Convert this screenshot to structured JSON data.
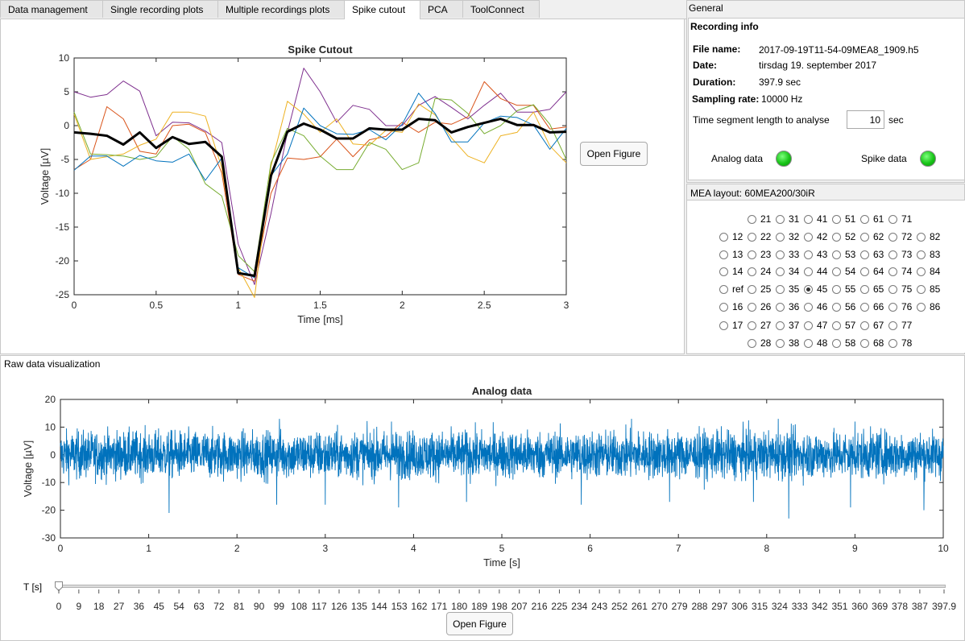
{
  "tabs": [
    {
      "label": "Data management",
      "active": false
    },
    {
      "label": "Single recording plots",
      "active": false
    },
    {
      "label": "Multiple recordings plots",
      "active": false
    },
    {
      "label": "Spike cutout",
      "active": true
    },
    {
      "label": "PCA",
      "active": false
    },
    {
      "label": "ToolConnect",
      "active": false
    }
  ],
  "general": {
    "title": "General",
    "recording_info": {
      "title": "Recording info",
      "file_name_label": "File name:",
      "file_name": "2017-09-19T11-54-09MEA8_1909.h5",
      "date_label": "Date:",
      "date": "tirsdag 19. september 2017",
      "duration_label": "Duration:",
      "duration": "397.9 sec",
      "sampling_label": "Sampling rate:",
      "sampling": "10000 Hz",
      "segment_label": "Time segment length to analyse",
      "segment_value": "10",
      "segment_unit": "sec",
      "analog_label": "Analog data",
      "spike_label": "Spike data",
      "status_color": "#18c418"
    }
  },
  "mea": {
    "title": "MEA layout: 60MEA200/30iR",
    "selected": "45",
    "rows": [
      [
        "",
        "21",
        "31",
        "41",
        "51",
        "61",
        "71",
        ""
      ],
      [
        "12",
        "22",
        "32",
        "42",
        "52",
        "62",
        "72",
        "82"
      ],
      [
        "13",
        "23",
        "33",
        "43",
        "53",
        "63",
        "73",
        "83"
      ],
      [
        "14",
        "24",
        "34",
        "44",
        "54",
        "64",
        "74",
        "84"
      ],
      [
        "ref",
        "25",
        "35",
        "45",
        "55",
        "65",
        "75",
        "85"
      ],
      [
        "16",
        "26",
        "36",
        "46",
        "56",
        "66",
        "76",
        "86"
      ],
      [
        "17",
        "27",
        "37",
        "47",
        "57",
        "67",
        "77",
        ""
      ],
      [
        "",
        "28",
        "38",
        "48",
        "58",
        "68",
        "78",
        ""
      ]
    ]
  },
  "spike_cutout": {
    "open_figure_label": "Open Figure"
  },
  "raw": {
    "title": "Raw data visualization",
    "slider_label": "T [s]",
    "slider_value": 0,
    "slider_ticks": [
      "0",
      "9",
      "18",
      "27",
      "36",
      "45",
      "54",
      "63",
      "72",
      "81",
      "90",
      "99",
      "108",
      "117",
      "126",
      "135",
      "144",
      "153",
      "162",
      "171",
      "180",
      "189",
      "198",
      "207",
      "216",
      "225",
      "234",
      "243",
      "252",
      "261",
      "270",
      "279",
      "288",
      "297",
      "306",
      "315",
      "324",
      "333",
      "342",
      "351",
      "360",
      "369",
      "378",
      "387",
      "397.9"
    ],
    "slider_max": 397.9,
    "open_figure_label": "Open Figure"
  },
  "chart_data": [
    {
      "type": "line",
      "title": "Spike Cutout",
      "xlabel": "Time [ms]",
      "ylabel": "Voltage  [µV]",
      "xlim": [
        0,
        3
      ],
      "ylim": [
        -25,
        10
      ],
      "xticks": [
        "0",
        "0.5",
        "1",
        "1.5",
        "2",
        "2.5",
        "3"
      ],
      "yticks": [
        "10",
        "5",
        "0",
        "-5",
        "-10",
        "-15",
        "-20",
        "-25"
      ],
      "x": [
        0,
        0.1,
        0.2,
        0.3,
        0.4,
        0.5,
        0.6,
        0.7,
        0.8,
        0.9,
        1.0,
        1.1,
        1.2,
        1.3,
        1.4,
        1.5,
        1.6,
        1.7,
        1.8,
        1.9,
        2.0,
        2.1,
        2.2,
        2.3,
        2.4,
        2.5,
        2.6,
        2.7,
        2.8,
        2.9,
        3.0
      ],
      "series": [
        {
          "color": "#7e2f8e",
          "width": 1,
          "values": [
            5,
            4.2,
            4.6,
            6.6,
            5.1,
            -1.5,
            0.5,
            0.4,
            -0.8,
            -2.5,
            -17.5,
            -23.5,
            -13,
            -1,
            8.5,
            5,
            0.5,
            3,
            2.4,
            0,
            0,
            3,
            4.3,
            2.7,
            1,
            3,
            4.8,
            2,
            2,
            2.4,
            5
          ]
        },
        {
          "color": "#d95319",
          "width": 1,
          "values": [
            -6.5,
            -5,
            2.8,
            1,
            -3.8,
            -4.2,
            0,
            0.2,
            -1,
            -7,
            -22,
            -23,
            -10,
            -4.8,
            -5,
            -4.6,
            -2,
            -4.6,
            -2.1,
            -1.6,
            0.5,
            -1,
            0.5,
            0.2,
            1.3,
            6.5,
            4,
            3,
            3,
            -0.5,
            -0.2
          ]
        },
        {
          "color": "#edb120",
          "width": 1,
          "values": [
            1.7,
            -5,
            -4.6,
            -4.2,
            -2.9,
            -2,
            2,
            2,
            1.4,
            -6.2,
            -21,
            -25.4,
            -6,
            3.6,
            1.7,
            -1,
            1,
            -2.7,
            -2.9,
            -0.7,
            -1,
            3.2,
            1.6,
            -1.8,
            -4.5,
            -5.5,
            -1.5,
            -1,
            2,
            -3,
            -5.5
          ]
        },
        {
          "color": "#77ac30",
          "width": 1,
          "values": [
            2,
            -4.2,
            -4.3,
            -4.5,
            -5,
            -4.6,
            -1.6,
            -3.5,
            -8.6,
            -10.4,
            -19.2,
            -21.6,
            -5.5,
            -0.4,
            -1.5,
            -4.5,
            -6.5,
            -6.5,
            -2.5,
            -3.5,
            -6.5,
            -5.5,
            4,
            3.8,
            1.8,
            -1.2,
            0,
            2.2,
            3.1,
            0.2,
            -5
          ]
        },
        {
          "color": "#0072bd",
          "width": 1,
          "values": [
            -6.6,
            -4.5,
            -4.5,
            -6,
            -4.4,
            -5.2,
            -5.4,
            -4.2,
            -8.1,
            -4.8,
            -21,
            -22.5,
            -7.4,
            -4.2,
            2.6,
            0,
            -1.2,
            -1.3,
            -0.6,
            -2.1,
            0.2,
            4.8,
            1.8,
            -2.4,
            -2.4,
            0.4,
            1.4,
            1.2,
            0.1,
            -3.5,
            -0.4
          ]
        },
        {
          "color": "#000000",
          "width": 3,
          "values": [
            -1,
            -1.2,
            -1.5,
            -2.8,
            -1,
            -3.3,
            -1.7,
            -2.7,
            -2.4,
            -4.6,
            -21.8,
            -22.2,
            -7.4,
            -0.9,
            0.3,
            -0.6,
            -1.9,
            -1.9,
            -0.4,
            -0.6,
            -0.6,
            1,
            0.8,
            -1,
            -0.2,
            0.4,
            1,
            0.1,
            0.1,
            -1,
            -0.9
          ]
        }
      ]
    },
    {
      "type": "line",
      "title": "Analog data",
      "xlabel": "Time [s]",
      "ylabel": "Voltage  [µV]",
      "xlim": [
        0,
        10
      ],
      "ylim": [
        -30,
        20
      ],
      "xticks": [
        "0",
        "1",
        "2",
        "3",
        "4",
        "5",
        "6",
        "7",
        "8",
        "9",
        "10"
      ],
      "yticks": [
        "20",
        "10",
        "0",
        "-10",
        "-20",
        "-30"
      ],
      "series": [
        {
          "color": "#0072bd",
          "noise": true,
          "amplitude": 11,
          "spikes": [
            [
              1.23,
              -21
            ],
            [
              2.45,
              -18
            ],
            [
              2.48,
              13
            ],
            [
              3.0,
              -18
            ],
            [
              3.83,
              -19
            ],
            [
              3.75,
              12
            ],
            [
              6.47,
              13
            ],
            [
              7.85,
              -17
            ],
            [
              8.13,
              13
            ],
            [
              8.25,
              -23
            ],
            [
              8.95,
              -19
            ],
            [
              9.0,
              12
            ],
            [
              9.78,
              -20
            ],
            [
              4.6,
              -17
            ],
            [
              5.9,
              -18
            ],
            [
              6.9,
              -17
            ]
          ]
        }
      ]
    }
  ]
}
